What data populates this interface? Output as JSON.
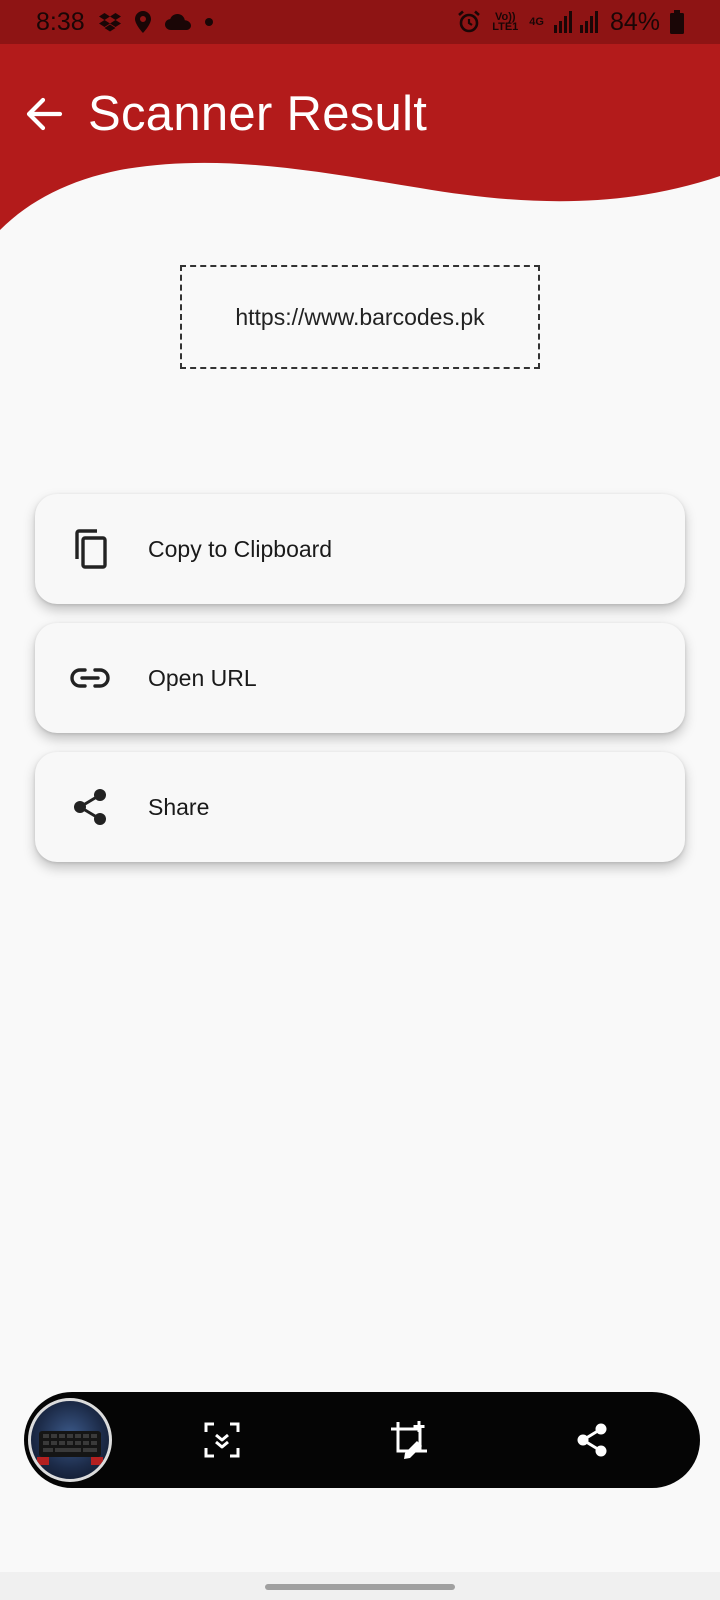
{
  "status_bar": {
    "time": "8:38",
    "volte_label": "Vo)) LTE1",
    "network_label": "4G",
    "battery_percent": "84%",
    "icons": [
      "dropbox-icon",
      "location-icon",
      "cloud-icon",
      "dot-icon",
      "alarm-icon",
      "volte-icon",
      "signal-icon",
      "battery-icon"
    ]
  },
  "header": {
    "title": "Scanner Result",
    "color": "#b31b1b"
  },
  "result": {
    "text": "https://www.barcodes.pk"
  },
  "actions": [
    {
      "label": "Copy to Clipboard",
      "icon": "copy-icon"
    },
    {
      "label": "Open URL",
      "icon": "link-icon"
    },
    {
      "label": "Share",
      "icon": "share-icon"
    }
  ],
  "bottom_toolbar": {
    "items": [
      "scanned-image-thumbnail",
      "scan-icon",
      "crop-edit-icon",
      "share-icon"
    ]
  }
}
